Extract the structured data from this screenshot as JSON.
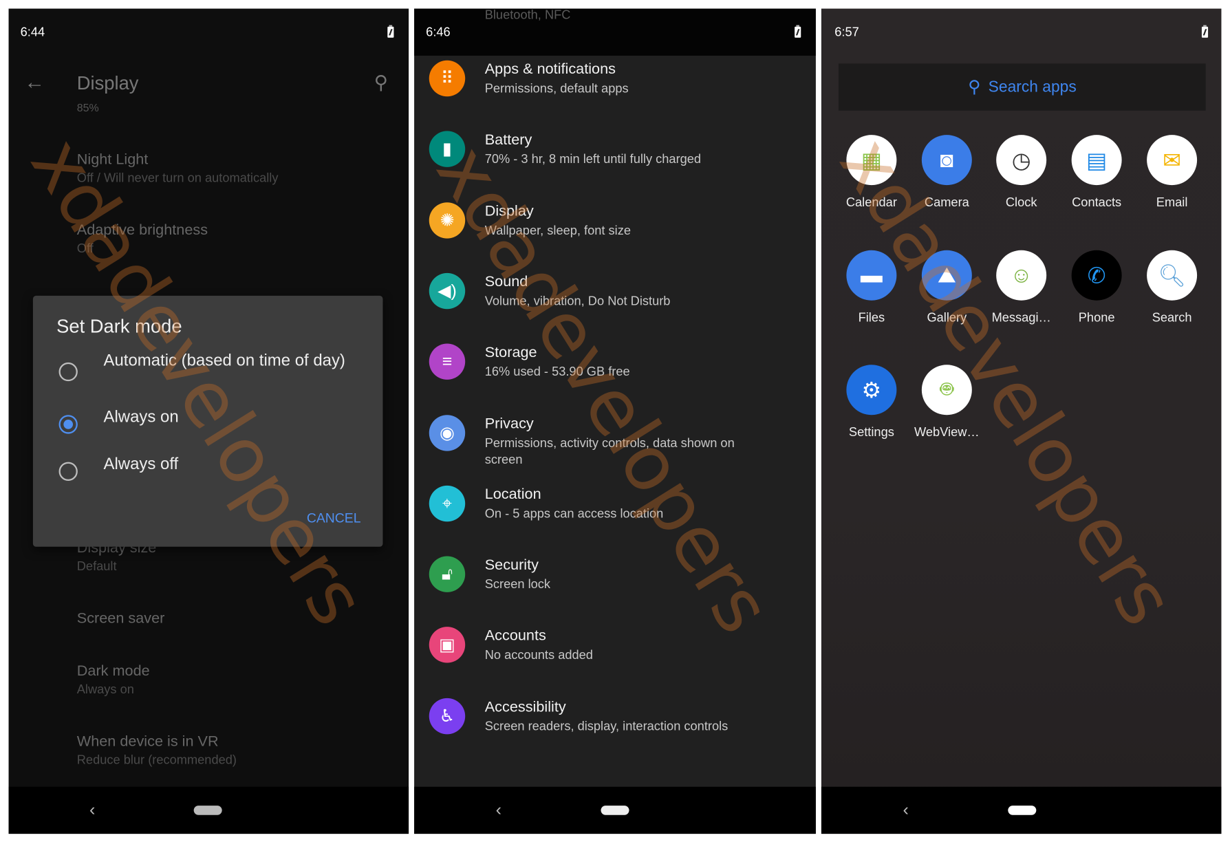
{
  "watermark": "xdadevelopers",
  "colors": {
    "accent": "#4f8ff0",
    "dialog_bg": "#3d3d3d"
  },
  "display_screen": {
    "status_time": "6:44",
    "title": "Display",
    "back_icon": "arrow-left-icon",
    "search_icon": "search-icon",
    "clipped_value": "85%",
    "settings": [
      {
        "title": "Night Light",
        "subtitle": "Off / Will never turn on automatically"
      },
      {
        "title": "Adaptive brightness",
        "subtitle": "Off"
      },
      {
        "title": "Display size",
        "subtitle": "Default"
      },
      {
        "title": "Screen saver",
        "subtitle": ""
      },
      {
        "title": "Dark mode",
        "subtitle": "Always on"
      },
      {
        "title": "When device is in VR",
        "subtitle": "Reduce blur (recommended)"
      }
    ],
    "dialog": {
      "title": "Set Dark mode",
      "options": [
        {
          "label": "Automatic (based on time of day)",
          "selected": false
        },
        {
          "label": "Always on",
          "selected": true
        },
        {
          "label": "Always off",
          "selected": false
        }
      ],
      "cancel": "CANCEL"
    }
  },
  "settings_screen": {
    "status_time": "6:46",
    "clipped_subtitle": "Bluetooth, NFC",
    "items": [
      {
        "title": "Apps & notifications",
        "subtitle": "Permissions, default apps",
        "icon": "apps-grid-icon",
        "color": "#f57c00",
        "glyph": "⠿"
      },
      {
        "title": "Battery",
        "subtitle": "70% - 3 hr, 8 min left until fully charged",
        "icon": "battery-icon",
        "color": "#00897b",
        "glyph": "▮"
      },
      {
        "title": "Display",
        "subtitle": "Wallpaper, sleep, font size",
        "icon": "brightness-icon",
        "color": "#f5a623",
        "glyph": "✺"
      },
      {
        "title": "Sound",
        "subtitle": "Volume, vibration, Do Not Disturb",
        "icon": "volume-icon",
        "color": "#17a79b",
        "glyph": "◀)"
      },
      {
        "title": "Storage",
        "subtitle": "16% used - 53.90 GB free",
        "icon": "storage-icon",
        "color": "#b144c8",
        "glyph": "≡"
      },
      {
        "title": "Privacy",
        "subtitle": "Permissions, activity controls, data shown on screen",
        "icon": "privacy-eye-icon",
        "color": "#5a8fe6",
        "glyph": "◉"
      },
      {
        "title": "Location",
        "subtitle": "On - 5 apps can access location",
        "icon": "location-pin-icon",
        "color": "#22bfd6",
        "glyph": "⌖"
      },
      {
        "title": "Security",
        "subtitle": "Screen lock",
        "icon": "lock-icon",
        "color": "#2e9e4f",
        "glyph": "🔓︎"
      },
      {
        "title": "Accounts",
        "subtitle": "No accounts added",
        "icon": "account-icon",
        "color": "#e8457a",
        "glyph": "▣"
      },
      {
        "title": "Accessibility",
        "subtitle": "Screen readers, display, interaction controls",
        "icon": "accessibility-icon",
        "color": "#7b3ff0",
        "glyph": "♿︎"
      }
    ]
  },
  "app_drawer": {
    "status_time": "6:57",
    "search_placeholder": "Search apps",
    "apps": [
      {
        "label": "Calendar",
        "icon": "calendar-icon",
        "bg": "#ffffff",
        "fg": "#8bc34a",
        "glyph": "▦"
      },
      {
        "label": "Camera",
        "icon": "camera-icon",
        "bg": "#3b7de8",
        "fg": "#ffffff",
        "glyph": "◙"
      },
      {
        "label": "Clock",
        "icon": "clock-icon",
        "bg": "#ffffff",
        "fg": "#333333",
        "glyph": "◷"
      },
      {
        "label": "Contacts",
        "icon": "contacts-icon",
        "bg": "#ffffff",
        "fg": "#1e88e5",
        "glyph": "▤"
      },
      {
        "label": "Email",
        "icon": "email-icon",
        "bg": "#ffffff",
        "fg": "#f4b400",
        "glyph": "✉"
      },
      {
        "label": "Files",
        "icon": "folder-icon",
        "bg": "#3b7de8",
        "fg": "#ffffff",
        "glyph": "▬"
      },
      {
        "label": "Gallery",
        "icon": "gallery-icon",
        "bg": "#3b7de8",
        "fg": "#ffffff",
        "glyph": "⛰"
      },
      {
        "label": "Messagi…",
        "icon": "messaging-icon",
        "bg": "#ffffff",
        "fg": "#7cb342",
        "glyph": "☺"
      },
      {
        "label": "Phone",
        "icon": "phone-icon",
        "bg": "#000000",
        "fg": "#2196f3",
        "glyph": "✆"
      },
      {
        "label": "Search",
        "icon": "magnifier-icon",
        "bg": "#ffffff",
        "fg": "#5aa0d8",
        "glyph": "🔍︎"
      },
      {
        "label": "Settings",
        "icon": "settings-gear-icon",
        "bg": "#1f6fe0",
        "fg": "#ffffff",
        "glyph": "⚙"
      },
      {
        "label": "WebView…",
        "icon": "android-icon",
        "bg": "#ffffff",
        "fg": "#8bc34a",
        "glyph": "🤖︎"
      }
    ]
  }
}
